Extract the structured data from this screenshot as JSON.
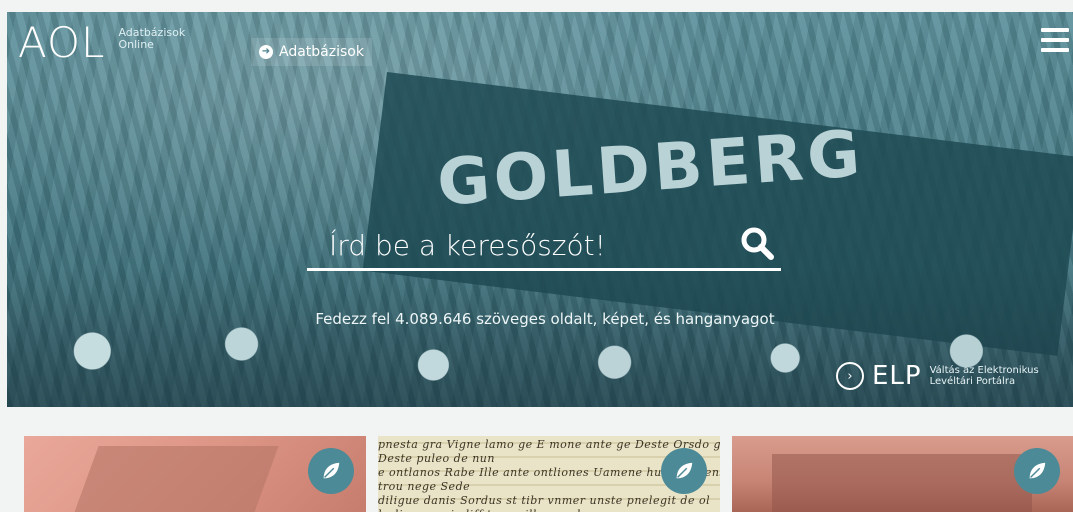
{
  "header": {
    "logo": "AOL",
    "logo_sub_line1": "Adatbázisok",
    "logo_sub_line2": "Online",
    "db_link_label": "Adatbázisok",
    "banner_text": "GOLDBERG"
  },
  "search": {
    "placeholder": "Írd be a keresőszót!"
  },
  "tagline": "Fedezz fel 4.089.646 szöveges oldalt, képet, és hanganyagot",
  "elp": {
    "mark": "ELP",
    "sub_line1": "Váltás az Elektronikus",
    "sub_line2": "Levéltári Portálra"
  },
  "cards": [
    {
      "icon": "leaf-icon"
    },
    {
      "icon": "leaf-icon",
      "script_line1": "pnesta gra Vigne lamo ge E mone ante ge Deste Orsdo ge Deste puleo de nun",
      "script_line2": "e ontlanos Rabe Ille ante ontliones Uamene hums negens trou nege Sede",
      "script_line3": "diligue danis Sordus st tibr vnmer unste pnelegit de ol brdia mege indiff tenge illuen subn"
    },
    {
      "icon": "leaf-icon"
    }
  ],
  "colors": {
    "hero_tint": "#477c87",
    "badge": "#4b8a96",
    "page_bg": "#f2f3f3"
  }
}
